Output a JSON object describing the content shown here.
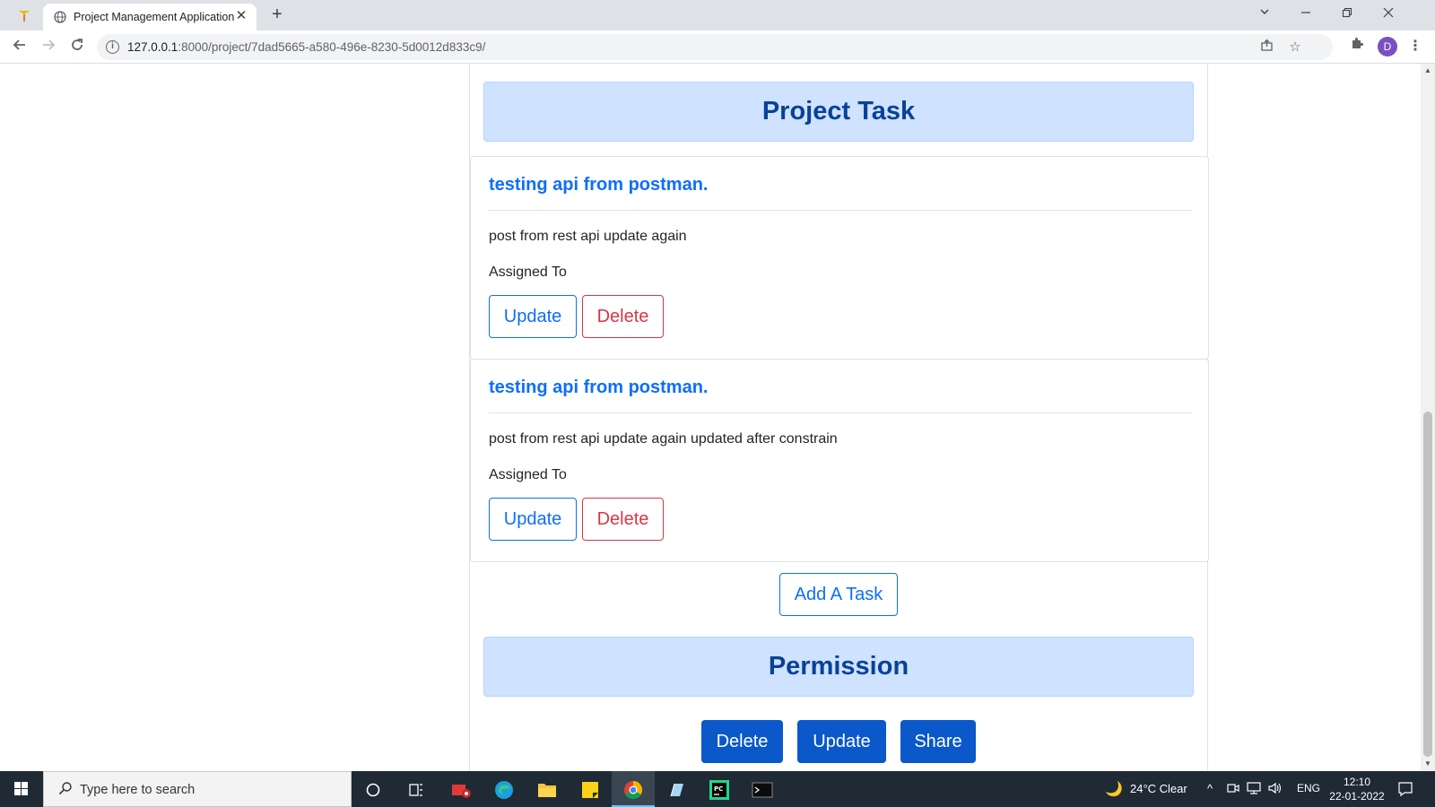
{
  "browser": {
    "tab_title": "Project Management Application",
    "tab_close": "✕",
    "new_tab": "+",
    "url_host": "127.0.0.1",
    "url_rest": ":8000/project/7dad5665-a580-496e-8230-5d0012d833c9/",
    "avatar_letter": "D"
  },
  "page": {
    "project_task_header": "Project Task",
    "tasks": [
      {
        "title": "testing api from postman.",
        "description": "post from rest api update again",
        "assigned_label": "Assigned To",
        "update_label": "Update",
        "delete_label": "Delete"
      },
      {
        "title": "testing api from postman.",
        "description": "post from rest api update again updated after constrain",
        "assigned_label": "Assigned To",
        "update_label": "Update",
        "delete_label": "Delete"
      }
    ],
    "add_task_label": "Add A Task",
    "permission_header": "Permission",
    "permission_buttons": {
      "delete": "Delete",
      "update": "Update",
      "share": "Share"
    }
  },
  "taskbar": {
    "search_placeholder": "Type here to search",
    "weather": "24°C  Clear",
    "language": "ENG",
    "time": "12:10",
    "date": "22-01-2022"
  },
  "colors": {
    "primary": "#0d6efd",
    "danger": "#dc3545",
    "header_bg": "#cfe2ff",
    "header_text": "#084298",
    "solid_button": "#0a58ca"
  }
}
